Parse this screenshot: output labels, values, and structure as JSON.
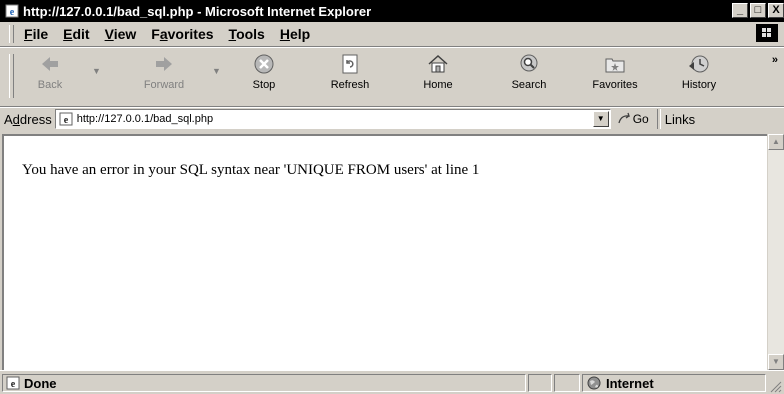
{
  "window": {
    "title": "http://127.0.0.1/bad_sql.php - Microsoft Internet Explorer",
    "minimize_glyph": "_",
    "maximize_glyph": "□",
    "close_glyph": "X"
  },
  "menubar": {
    "items": [
      {
        "pre": "",
        "key": "F",
        "post": "ile"
      },
      {
        "pre": "",
        "key": "E",
        "post": "dit"
      },
      {
        "pre": "",
        "key": "V",
        "post": "iew"
      },
      {
        "pre": "F",
        "key": "a",
        "post": "vorites"
      },
      {
        "pre": "",
        "key": "T",
        "post": "ools"
      },
      {
        "pre": "",
        "key": "H",
        "post": "elp"
      }
    ]
  },
  "toolbar": {
    "back": "Back",
    "forward": "Forward",
    "stop": "Stop",
    "refresh": "Refresh",
    "home": "Home",
    "search": "Search",
    "favorites": "Favorites",
    "history": "History",
    "chevron": "»"
  },
  "addressbar": {
    "label_key": "d",
    "label_pre": "A",
    "label_post": "dress",
    "url": "http://127.0.0.1/bad_sql.php",
    "go": "Go",
    "links": "Links"
  },
  "page": {
    "message": "You have an error in your SQL syntax near 'UNIQUE FROM users' at line 1"
  },
  "statusbar": {
    "status": "Done",
    "zone": "Internet"
  },
  "icons": {
    "app": "ie-page-icon",
    "back": "back-arrow-icon",
    "forward": "forward-arrow-icon",
    "stop": "stop-icon",
    "refresh": "refresh-icon",
    "home": "home-icon",
    "search": "search-icon",
    "favorites": "favorites-icon",
    "history": "history-icon",
    "go": "go-arrow-icon",
    "zone": "globe-icon"
  }
}
